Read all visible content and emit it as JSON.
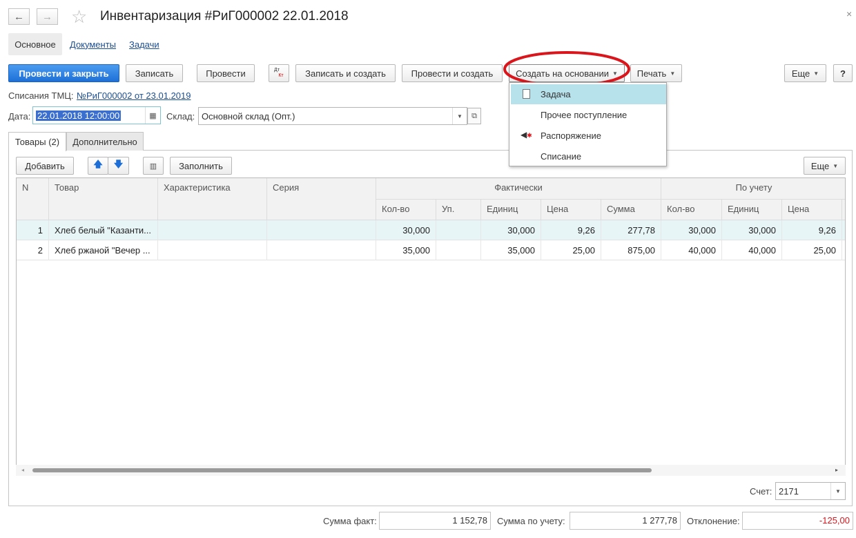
{
  "header": {
    "title": "Инвентаризация #РиГ000002 22.01.2018",
    "back_icon": "←",
    "forward_icon": "→",
    "star_icon": "☆",
    "close_icon": "×"
  },
  "nav_tabs": {
    "main": "Основное",
    "documents": "Документы",
    "tasks": "Задачи"
  },
  "toolbar": {
    "post_and_close": "Провести и закрыть",
    "save": "Записать",
    "post": "Провести",
    "dt_kt_top": "Дт",
    "dt_kt_bottom": "Кт",
    "save_and_create": "Записать и создать",
    "post_and_create": "Провести и создать",
    "create_based_on": "Создать на основании",
    "print": "Печать",
    "more": "Еще",
    "help": "?"
  },
  "dropdown": {
    "items": [
      "Задача",
      "Прочее поступление",
      "Распоряжение",
      "Списание"
    ],
    "selected_index": 0
  },
  "writeoff": {
    "label": "Списания ТМЦ:",
    "link": "№РиГ000002 от 23.01.2019"
  },
  "form": {
    "date_label": "Дата:",
    "date_value": "22.01.2018 12:00:00",
    "warehouse_label": "Склад:",
    "warehouse_value": "Основной склад (Опт.)"
  },
  "tabs": {
    "goods": "Товары (2)",
    "additional": "Дополнительно"
  },
  "table_toolbar": {
    "add": "Добавить",
    "fill": "Заполнить",
    "more": "Еще"
  },
  "table": {
    "headers": {
      "n": "N",
      "product": "Товар",
      "characteristic": "Характеристика",
      "series": "Серия",
      "actual": "Фактически",
      "accounting": "По учету",
      "qty": "Кол-во",
      "pack": "Уп.",
      "units": "Единиц",
      "price": "Цена",
      "sum": "Сумма",
      "acc_qty": "Кол-во",
      "acc_units": "Единиц",
      "acc_price": "Цена"
    },
    "rows": [
      {
        "n": "1",
        "product": "Хлеб белый \"Казанти...",
        "qty": "30,000",
        "units": "30,000",
        "price": "9,26",
        "sum": "277,78",
        "acc_qty": "30,000",
        "acc_units": "30,000",
        "acc_price": "9,26"
      },
      {
        "n": "2",
        "product": "Хлеб ржаной \"Вечер ...",
        "qty": "35,000",
        "units": "35,000",
        "price": "25,00",
        "sum": "875,00",
        "acc_qty": "40,000",
        "acc_units": "40,000",
        "acc_price": "25,00"
      }
    ]
  },
  "account": {
    "label": "Счет:",
    "value": "2171"
  },
  "totals": {
    "actual_label": "Сумма факт:",
    "actual_value": "1 152,78",
    "accounting_label": "Сумма по учету:",
    "accounting_value": "1 277,78",
    "deviation_label": "Отклонение:",
    "deviation_value": "-125,00"
  },
  "colors": {
    "accent": "#1d6fd7",
    "highlight_ring": "#d9161c",
    "selected_row": "#e8f5f7",
    "negative": "#d9161c"
  }
}
